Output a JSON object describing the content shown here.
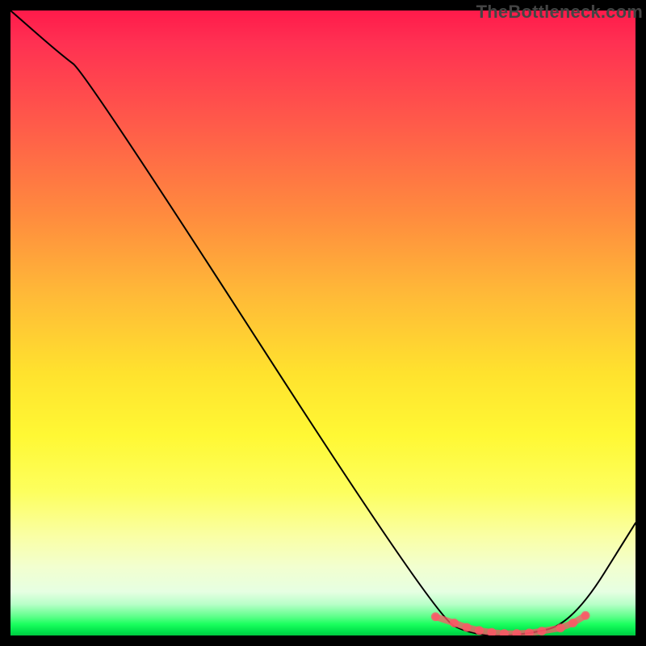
{
  "watermark": "TheBottleneck.com",
  "colors": {
    "frame_bg": "#000000",
    "curve_stroke": "#000000",
    "marker_fill": "#ff5566",
    "gradient_top": "#ff1a4a",
    "gradient_bottom": "#00c840"
  },
  "chart_data": {
    "type": "line",
    "title": "",
    "xlabel": "",
    "ylabel": "",
    "xlim": [
      0,
      100
    ],
    "ylim": [
      0,
      100
    ],
    "grid": false,
    "watermark": "TheBottleneck.com",
    "series": [
      {
        "name": "bottleneck-curve",
        "x": [
          0,
          8,
          12,
          68,
          74,
          82,
          90,
          100
        ],
        "values": [
          100,
          93,
          90,
          3,
          0,
          0,
          2,
          18
        ]
      }
    ],
    "highlight": {
      "name": "optimal-range",
      "x_approx": [
        68,
        71,
        73,
        75,
        77,
        79,
        81,
        83,
        85,
        88,
        90,
        92
      ],
      "values": [
        3,
        2,
        1.3,
        0.8,
        0.5,
        0.3,
        0.3,
        0.4,
        0.7,
        1.2,
        2,
        3.2
      ]
    }
  }
}
